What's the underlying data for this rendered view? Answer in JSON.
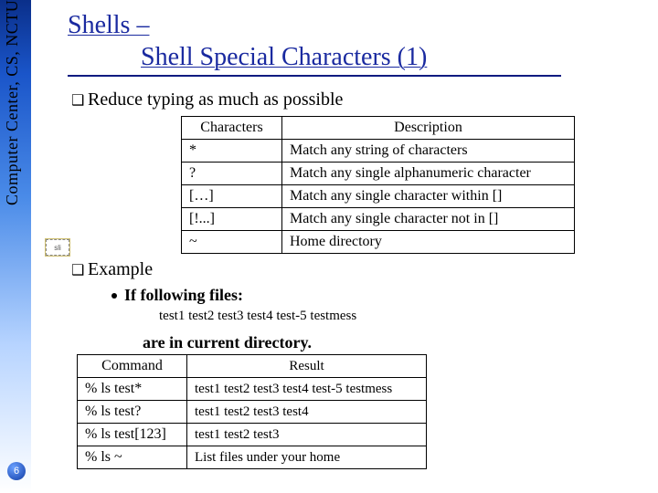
{
  "sidebar": {
    "org_text": "Computer Center, CS, NCTU"
  },
  "page_number": "6",
  "title": {
    "line1": "Shells –",
    "line2": "Shell Special Characters (1)"
  },
  "bullets": {
    "reduce": "Reduce typing as much as possible",
    "example": "Example"
  },
  "table1": {
    "headers": [
      "Characters",
      "Description"
    ],
    "rows": [
      {
        "c": "*",
        "d": "Match any string of characters"
      },
      {
        "c": "?",
        "d": "Match any single alphanumeric character"
      },
      {
        "c": "[…]",
        "d": "Match any single character within []"
      },
      {
        "c": "[!...]",
        "d": "Match any single character not in []"
      },
      {
        "c": "~",
        "d": "Home directory"
      }
    ]
  },
  "example": {
    "if_line": "If following files:",
    "files": "test1 test2 test3 test4 test-5 testmess",
    "are_in": "are in current directory."
  },
  "table2": {
    "headers": [
      "Command",
      "Result"
    ],
    "rows": [
      {
        "c": "% ls test*",
        "r": "test1 test2 test3 test4 test-5 testmess"
      },
      {
        "c": "% ls test?",
        "r": "test1 test2 test3 test4"
      },
      {
        "c": "% ls test[123]",
        "r": "test1 test2 test3"
      },
      {
        "c": "% ls ~",
        "r": "List files under your home"
      }
    ]
  },
  "icon": {
    "sli_label": "sli"
  }
}
